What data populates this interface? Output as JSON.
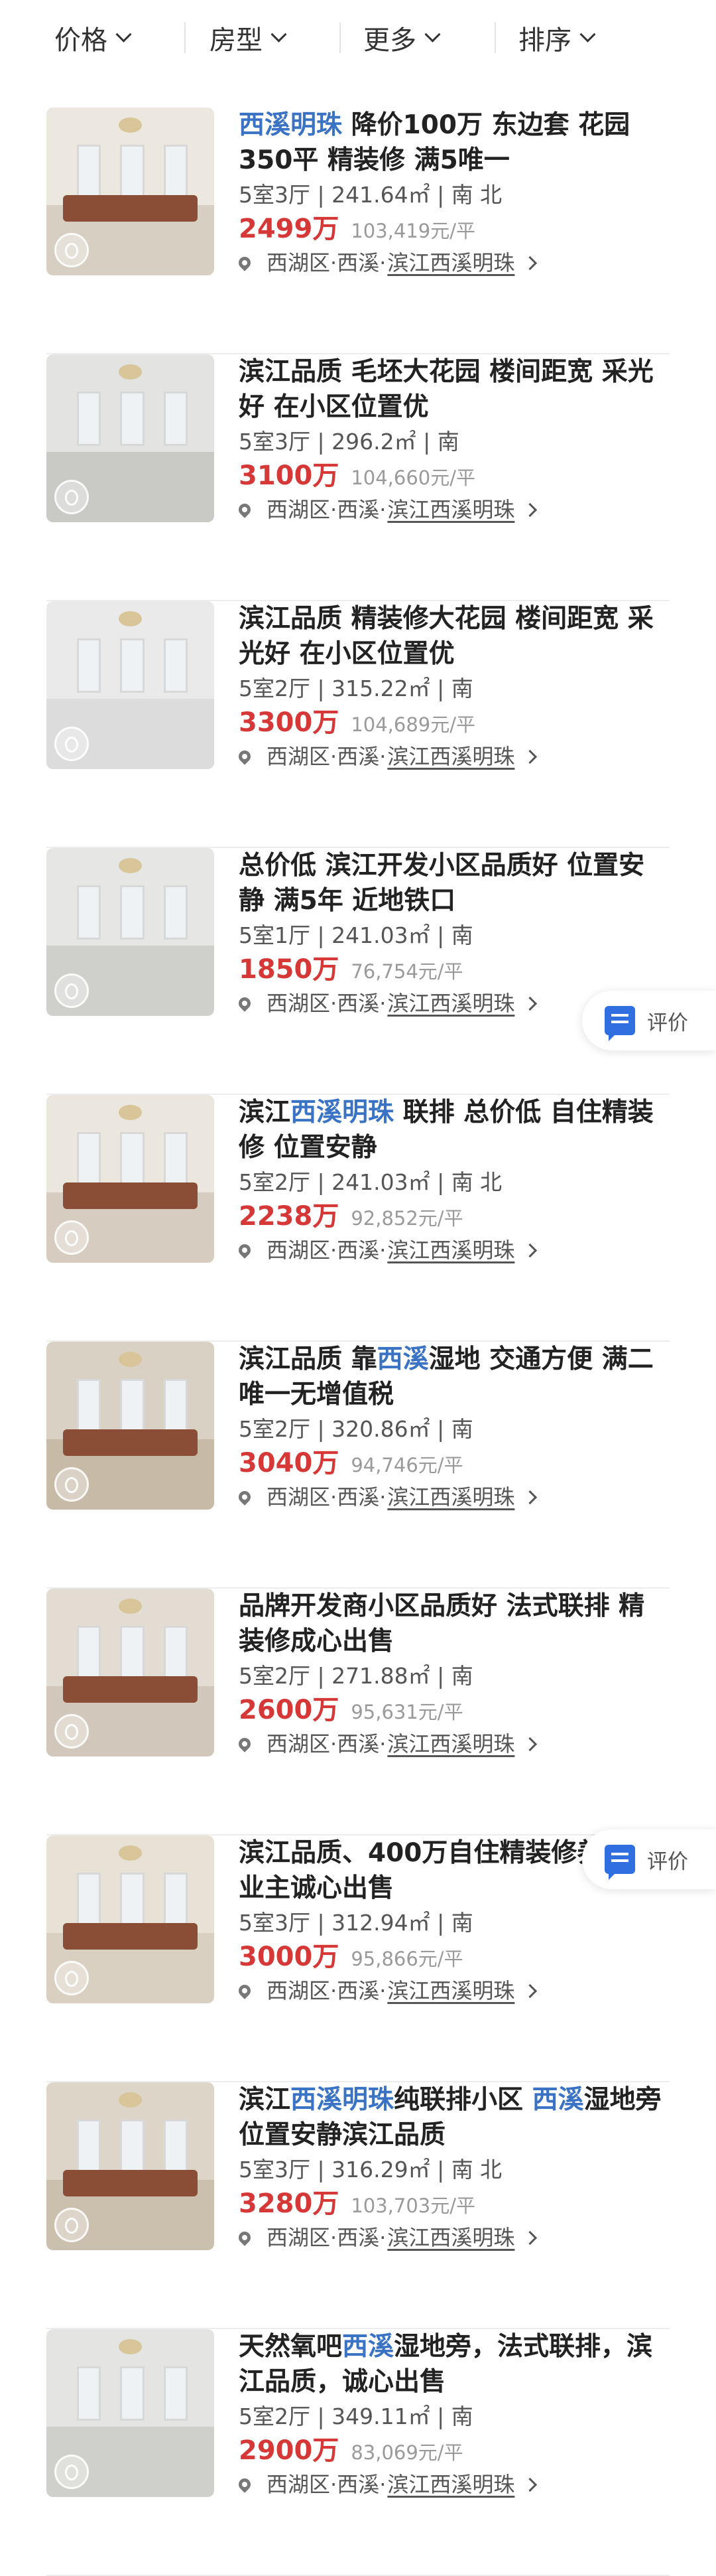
{
  "filters": [
    {
      "label": "价格"
    },
    {
      "label": "房型"
    },
    {
      "label": "更多"
    },
    {
      "label": "排序"
    }
  ],
  "review_button": {
    "label": "评价"
  },
  "listings": [
    {
      "title_parts": [
        {
          "t": "西溪明珠",
          "hl": true
        },
        {
          "t": " 降价100万 东边套 花园350平 精装修 满5唯一",
          "hl": false
        }
      ],
      "layout": "5室3厅",
      "area": "241.64㎡",
      "orientation": "南 北",
      "price": "2499万",
      "unit_price": "103,419元/平",
      "district": "西湖区",
      "area_name": "西溪",
      "community": "滨江西溪明珠",
      "thumb": {
        "wall": "#ece7df",
        "floor": "#d8cfc3",
        "furniture": true
      }
    },
    {
      "title_parts": [
        {
          "t": "滨江品质 毛坯大花园 楼间距宽 采光好 在小区位置优",
          "hl": false
        }
      ],
      "layout": "5室3厅",
      "area": "296.2㎡",
      "orientation": "南",
      "price": "3100万",
      "unit_price": "104,660元/平",
      "district": "西湖区",
      "area_name": "西溪",
      "community": "滨江西溪明珠",
      "thumb": {
        "wall": "#e3e3e1",
        "floor": "#c9c9c6",
        "furniture": false
      }
    },
    {
      "title_parts": [
        {
          "t": "滨江品质 精装修大花园 楼间距宽 采光好 在小区位置优",
          "hl": false
        }
      ],
      "layout": "5室2厅",
      "area": "315.22㎡",
      "orientation": "南",
      "price": "3300万",
      "unit_price": "104,689元/平",
      "district": "西湖区",
      "area_name": "西溪",
      "community": "滨江西溪明珠",
      "thumb": {
        "wall": "#eaeaea",
        "floor": "#dcdcdc",
        "furniture": false
      }
    },
    {
      "title_parts": [
        {
          "t": "总价低 滨江开发小区品质好 位置安静 满5年 近地铁口",
          "hl": false
        }
      ],
      "layout": "5室1厅",
      "area": "241.03㎡",
      "orientation": "南",
      "price": "1850万",
      "unit_price": "76,754元/平",
      "district": "西湖区",
      "area_name": "西溪",
      "community": "滨江西溪明珠",
      "thumb": {
        "wall": "#e6e6e4",
        "floor": "#cfcfcc",
        "furniture": false
      }
    },
    {
      "title_parts": [
        {
          "t": "滨江",
          "hl": false
        },
        {
          "t": "西溪明珠",
          "hl": true
        },
        {
          "t": " 联排 总价低 自住精装修 位置安静",
          "hl": false
        }
      ],
      "layout": "5室2厅",
      "area": "241.03㎡",
      "orientation": "南 北",
      "price": "2238万",
      "unit_price": "92,852元/平",
      "district": "西湖区",
      "area_name": "西溪",
      "community": "滨江西溪明珠",
      "thumb": {
        "wall": "#ebe6de",
        "floor": "#d6cdc0",
        "furniture": true
      }
    },
    {
      "title_parts": [
        {
          "t": "滨江品质 靠",
          "hl": false
        },
        {
          "t": "西溪",
          "hl": true
        },
        {
          "t": "湿地 交通方便 满二唯一无增值税",
          "hl": false
        }
      ],
      "layout": "5室2厅",
      "area": "320.86㎡",
      "orientation": "南",
      "price": "3040万",
      "unit_price": "94,746元/平",
      "district": "西湖区",
      "area_name": "西溪",
      "community": "滨江西溪明珠",
      "thumb": {
        "wall": "#d9d2c4",
        "floor": "#c7bba8",
        "furniture": true
      }
    },
    {
      "title_parts": [
        {
          "t": "品牌开发商小区品质好 法式联排 精装修成心出售",
          "hl": false
        }
      ],
      "layout": "5室2厅",
      "area": "271.88㎡",
      "orientation": "南",
      "price": "2600万",
      "unit_price": "95,631元/平",
      "district": "西湖区",
      "area_name": "西溪",
      "community": "滨江西溪明珠",
      "thumb": {
        "wall": "#e2dcd2",
        "floor": "#d1c8bb",
        "furniture": true
      }
    },
    {
      "title_parts": [
        {
          "t": "滨江品质、400万自住精装修养佳、业主诚心出售",
          "hl": false
        }
      ],
      "layout": "5室3厅",
      "area": "312.94㎡",
      "orientation": "南",
      "price": "3000万",
      "unit_price": "95,866元/平",
      "district": "西湖区",
      "area_name": "西溪",
      "community": "滨江西溪明珠",
      "thumb": {
        "wall": "#e8e2d6",
        "floor": "#d9d0c2",
        "furniture": true
      }
    },
    {
      "title_parts": [
        {
          "t": "滨江",
          "hl": false
        },
        {
          "t": "西溪明珠",
          "hl": true
        },
        {
          "t": "纯联排小区 ",
          "hl": false
        },
        {
          "t": "西溪",
          "hl": true
        },
        {
          "t": "湿地旁位置安静滨江品质",
          "hl": false
        }
      ],
      "layout": "5室3厅",
      "area": "316.29㎡",
      "orientation": "南 北",
      "price": "3280万",
      "unit_price": "103,703元/平",
      "district": "西湖区",
      "area_name": "西溪",
      "community": "滨江西溪明珠",
      "thumb": {
        "wall": "#ddd5c8",
        "floor": "#cbbfae",
        "furniture": true
      }
    },
    {
      "title_parts": [
        {
          "t": "天然氧吧",
          "hl": false
        },
        {
          "t": "西溪",
          "hl": true
        },
        {
          "t": "湿地旁，法式联排，滨江品质，诚心出售",
          "hl": false
        }
      ],
      "layout": "5室2厅",
      "area": "349.11㎡",
      "orientation": "南",
      "price": "2900万",
      "unit_price": "83,069元/平",
      "district": "西湖区",
      "area_name": "西溪",
      "community": "滨江西溪明珠",
      "thumb": {
        "wall": "#e4e4e2",
        "floor": "#cfcfcb",
        "furniture": false
      }
    }
  ]
}
